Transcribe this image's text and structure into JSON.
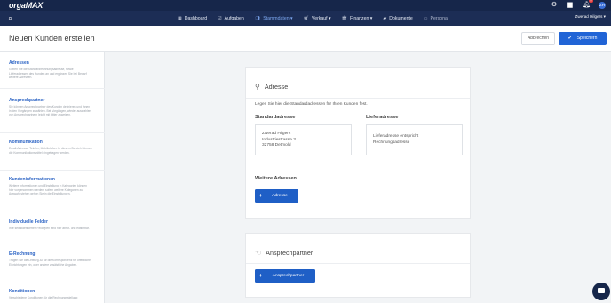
{
  "app": {
    "logo_main": "orga",
    "logo_accent": "MAX",
    "company": "Zwerad Hilgers ▾",
    "avatar": "ZH",
    "notification_count": "9"
  },
  "nav": {
    "items": [
      {
        "label": "Dashboard",
        "icon": "grid-icon"
      },
      {
        "label": "Aufgaben",
        "icon": "check-icon"
      },
      {
        "label": "Stammdaten ▾",
        "icon": "people-icon",
        "active": true
      },
      {
        "label": "Verkauf ▾",
        "icon": "cart-icon"
      },
      {
        "label": "Finanzen ▾",
        "icon": "bank-icon"
      },
      {
        "label": "Dokumente",
        "icon": "folder-icon"
      },
      {
        "label": "Personal",
        "icon": "id-card-icon"
      }
    ]
  },
  "header": {
    "title": "Neuen Kunden erstellen",
    "cancel_label": "Abbrechen",
    "save_label": "Speichern"
  },
  "sidebar": {
    "items": [
      {
        "title": "Adressen",
        "desc": "Geben Sie die Standardrechnungsadresse, sowie Lieferadressen des Kunden an und ergänzen Sie bei Bedarf weitere Adressen."
      },
      {
        "title": "Ansprechpartner",
        "desc": "Sie können Ansprechpartner des Kunden definieren und Ihnen in den Vorgängen zuwählen. Bei Vorgängen, wieder auswahlen von Ansprechpartnern leicht mit bitter zuweisen."
      },
      {
        "title": "Kommunikation",
        "desc": "Email-Adresse, Telefon, Mobiltelefon. In diesem Bereich können die Kommunikationsmittel eingetragen werden."
      },
      {
        "title": "Kundeninformationen",
        "desc": "Weitere Informationen und Einstellung in Kategorien können hier vorgenommen werden, sofern weitere Kategorien zur Auswahl stehen gehen Sie in die Einstellungen."
      },
      {
        "title": "Individuelle Felder",
        "desc": "Ihre selbstdefinierten Feldtypen sind hier abruf- und editierbar."
      },
      {
        "title": "E-Rechnung",
        "desc": "Tragen Sie die Leitweg-ID für die Korrespondenz für öffentliche Einrichtungen ein, oder andere zusätzliche Angaben."
      },
      {
        "title": "Konditionen",
        "desc": "Verschiedene Konditionen für die Rechnungsstellung"
      }
    ]
  },
  "address_card": {
    "title": "Adresse",
    "intro": "Legen Sie hier die Standardadressen für Ihren Kunden fest.",
    "standard_title": "Standardadresse",
    "standard_lines": [
      "Zwerad Hilgers",
      "Industriestrasse 3",
      "32758 Detmold"
    ],
    "delivery_title": "Lieferadresse",
    "delivery_lines": [
      "Lieferadresse entspricht",
      "Rechnungsadresse"
    ],
    "more_title": "Weitere Adressen",
    "add_button": "Adresse"
  },
  "contact_card": {
    "title": "Ansprechpartner",
    "add_button": "Ansprechpartner"
  },
  "colors": {
    "topbar": "#16264a",
    "navbar": "#1c2d55",
    "accent": "#2164d6",
    "link": "#2b63c4"
  }
}
